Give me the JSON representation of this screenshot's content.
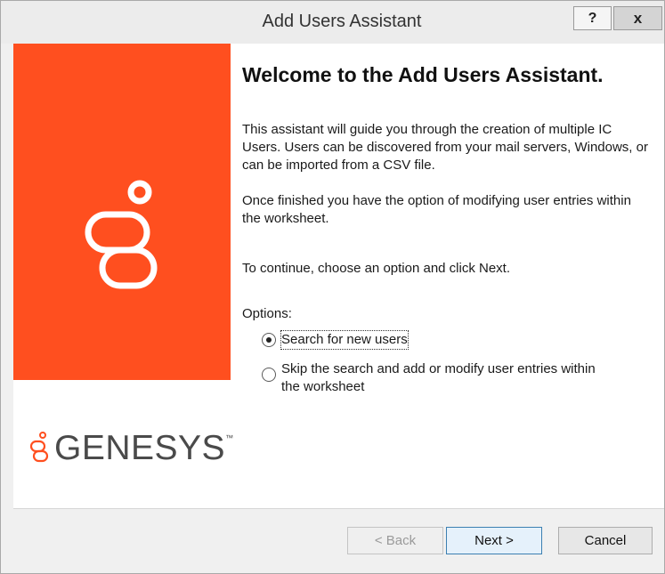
{
  "window": {
    "title": "Add Users Assistant",
    "help_label": "?",
    "close_label": "x"
  },
  "brand": {
    "wordmark": "GENESYS",
    "trademark": "™",
    "accent_color": "#ff4f1f"
  },
  "main": {
    "heading": "Welcome to the Add Users Assistant.",
    "intro": "This assistant will guide you through the creation of multiple IC Users. Users can be discovered from your mail servers, Windows, or can be imported from a CSV file.",
    "worksheet_note": "Once finished you have the option of modifying user entries within the worksheet.",
    "continue_text": "To continue, choose an option and click Next.",
    "options_label": "Options:",
    "options": [
      {
        "label": "Search for new users",
        "selected": true
      },
      {
        "label": "Skip the search and add or modify user entries within the worksheet",
        "selected": false
      }
    ]
  },
  "footer": {
    "back_label": "< Back",
    "next_label": "Next >",
    "cancel_label": "Cancel"
  }
}
